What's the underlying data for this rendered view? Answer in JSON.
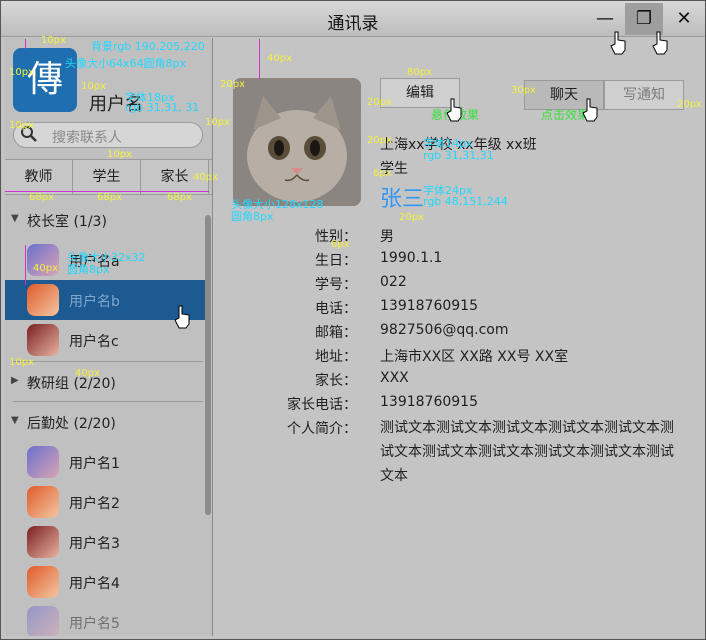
{
  "window": {
    "title": "通讯录",
    "controls": {
      "minimize": "—",
      "maximize": "❐",
      "close": "✕"
    }
  },
  "profile": {
    "avatar_char": "傳",
    "username": "用户名",
    "search_placeholder": "搜索联系人"
  },
  "tabs": [
    "教师",
    "学生",
    "家长"
  ],
  "groups": [
    {
      "label": "校长室 (1/3)",
      "expanded": true,
      "members": [
        "用户名a",
        "用户名b",
        "用户名c"
      ],
      "selected_index": 1
    },
    {
      "label": "教研组 (2/20)",
      "expanded": false,
      "members": []
    },
    {
      "label": "后勤处 (2/20)",
      "expanded": true,
      "members": [
        "用户名1",
        "用户名2",
        "用户名3",
        "用户名4",
        "用户名5"
      ]
    }
  ],
  "detail": {
    "buttons": {
      "edit": "编辑",
      "chat": "聊天",
      "notify": "写通知"
    },
    "school_line": "上海xx学校 xx年级  xx班",
    "role": "学生",
    "realname": "张三",
    "fields": [
      {
        "key": "性别：",
        "value": "男"
      },
      {
        "key": "生日：",
        "value": "1990.1.1"
      },
      {
        "key": "学号：",
        "value": "022"
      },
      {
        "key": "电话：",
        "value": "13918760915"
      },
      {
        "key": "邮箱：",
        "value": "9827506@qq.com"
      },
      {
        "key": "地址：",
        "value": "上海市XX区 XX路 XX号 XX室"
      },
      {
        "key": "家长：",
        "value": "XXX"
      },
      {
        "key": "家长电话：",
        "value": "13918760915"
      },
      {
        "key": "个人简介：",
        "value": ""
      }
    ],
    "bio": "测试文本测试文本测试文本测试文本测试文本测试文本测试文本测试文本测试文本测试文本测试文本"
  },
  "annotations": {
    "bg_note": "背景rgb 190.205,220",
    "avatar_note": "头像大小64x64圆角8px",
    "font18_note": "字体18px",
    "rgb31_note": "rgb 31,31, 31",
    "hover_note": "悬停效果",
    "click_note": "点击效果",
    "font14_note": "字体14px",
    "font14_rgb": "rgb 31,31,31",
    "font24_note": "字体24px",
    "font24_rgb": "rgb 48,151,244",
    "photo_note": "头像大小128x128",
    "photo_radius": "圆角8px",
    "small_avatar_note": "头像大小32x32",
    "small_avatar_radius": "圆角8px",
    "px10": "10px",
    "px20": "20px",
    "px30": "30px",
    "px40": "40px",
    "px80": "80px",
    "px68": "68px",
    "px6": "6px"
  },
  "colors": {
    "selected_row": "#1d5a92",
    "realname": "#3097f4",
    "annotation_text": "#21d8ff",
    "measure_text": "#f3f03f",
    "effect_text": "#36e13b",
    "measure_line": "#cc33cc"
  }
}
